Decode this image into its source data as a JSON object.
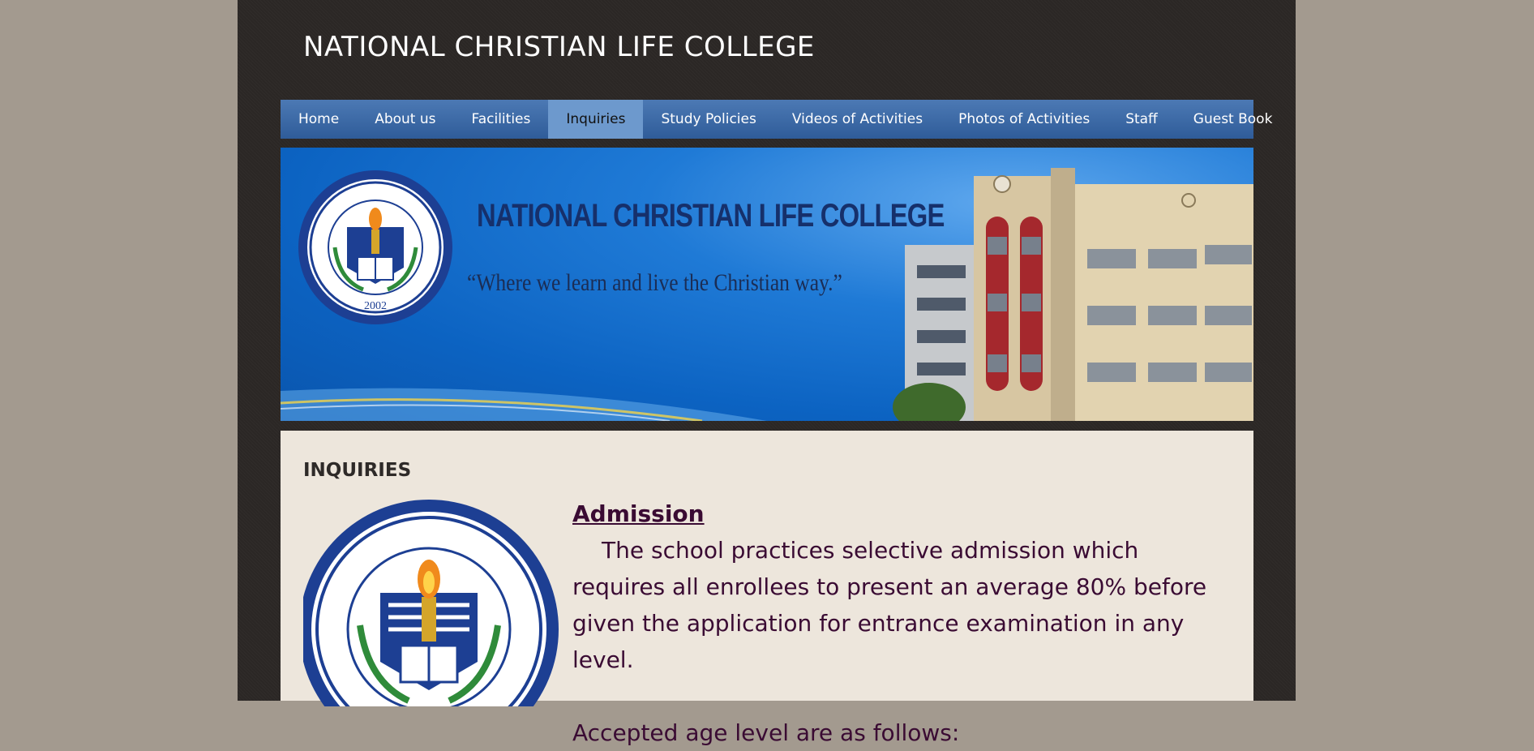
{
  "site": {
    "title": "NATIONAL CHRISTIAN LIFE COLLEGE"
  },
  "nav": {
    "items": [
      {
        "label": "Home",
        "active": false
      },
      {
        "label": "About us",
        "active": false
      },
      {
        "label": "Facilities",
        "active": false
      },
      {
        "label": "Inquiries",
        "active": true
      },
      {
        "label": "Study Policies",
        "active": false
      },
      {
        "label": "Videos of Activities",
        "active": false
      },
      {
        "label": "Photos of Activities",
        "active": false
      },
      {
        "label": "Staff",
        "active": false
      },
      {
        "label": "Guest Book",
        "active": false
      }
    ]
  },
  "banner": {
    "title": "NATIONAL CHRISTIAN LIFE COLLEGE",
    "tagline": "“Where we learn and live the Christian way.”",
    "seal_text": "NATIONAL CHRISTIAN LIFE COLLEGE",
    "seal_year": "2002"
  },
  "main": {
    "section_heading": "INQUIRIES",
    "seal_text": "NATIONAL CHRISTIAN LIFE COLLEGE",
    "article": {
      "heading": "Admission",
      "paragraph": "The school practices selective admission which requires all enrollees to present an average 80% before given the application for entrance examination in any level.",
      "ages_intro": "Accepted age level are as follows:"
    }
  },
  "colors": {
    "background": "#a39a8f",
    "page": "#2b2725",
    "nav": "#3a67a6",
    "nav_active": "#6d99cd",
    "content_bg": "#ede6dc",
    "article_text": "#3a0b33",
    "seal_blue": "#1d3f93"
  }
}
